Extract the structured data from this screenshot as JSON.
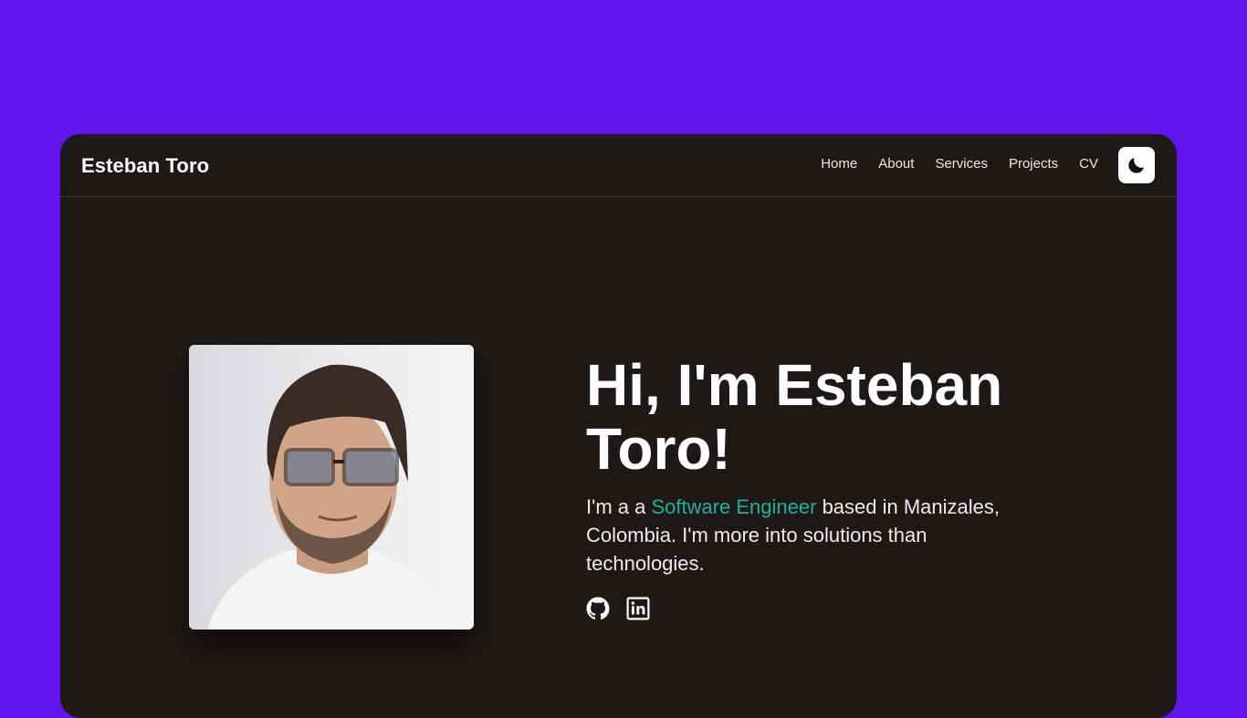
{
  "brand": {
    "name": "Esteban Toro"
  },
  "nav": {
    "items": [
      {
        "label": "Home"
      },
      {
        "label": "About"
      },
      {
        "label": "Services"
      },
      {
        "label": "Projects"
      },
      {
        "label": "CV"
      }
    ],
    "theme_toggle_icon": "moon-icon"
  },
  "hero": {
    "title": "Hi, I'm Esteban Toro!",
    "intro_before": "I'm a a ",
    "intro_highlight": "Software Engineer",
    "intro_after": " based in Manizales, Colombia. I'm more into solutions than technologies.",
    "socials": [
      {
        "icon": "github-icon"
      },
      {
        "icon": "linkedin-icon"
      }
    ]
  },
  "colors": {
    "page_background": "#5f15ec",
    "card_background": "#1e1917",
    "accent": "#1bb39b",
    "text": "#ffffff"
  }
}
